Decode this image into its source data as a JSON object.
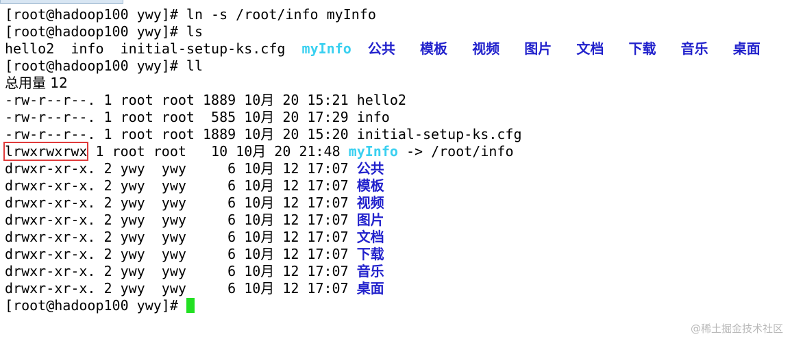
{
  "terminal": {
    "prompt": "[root@hadoop100 ywy]#",
    "commands": {
      "ln": "ln -s /root/info myInfo",
      "ls": "ls",
      "ll": "ll"
    },
    "ls_output": {
      "files": [
        "hello2",
        "info",
        "initial-setup-ks.cfg"
      ],
      "symlink": "myInfo",
      "dirs": [
        "公共",
        "模板",
        "视频",
        "图片",
        "文档",
        "下载",
        "音乐",
        "桌面"
      ]
    },
    "ll_output": {
      "total": "总用量 12",
      "files": [
        {
          "meta": "-rw-r--r--. 1 root root 1889 10月 20 15:21 ",
          "name": "hello2"
        },
        {
          "meta": "-rw-r--r--. 1 root root  585 10月 20 17:29 ",
          "name": "info"
        },
        {
          "meta": "-rw-r--r--. 1 root root 1889 10月 20 15:20 ",
          "name": "initial-setup-ks.cfg"
        }
      ],
      "symlink": {
        "perms": "lrwxrwxrwx",
        "meta": " 1 root root   10 10月 20 21:48 ",
        "name": "myInfo",
        "target": " -> /root/info"
      },
      "dirs": [
        {
          "meta": "drwxr-xr-x. 2 ywy  ywy     6 10月 12 17:07 ",
          "name": "公共"
        },
        {
          "meta": "drwxr-xr-x. 2 ywy  ywy     6 10月 12 17:07 ",
          "name": "模板"
        },
        {
          "meta": "drwxr-xr-x. 2 ywy  ywy     6 10月 12 17:07 ",
          "name": "视频"
        },
        {
          "meta": "drwxr-xr-x. 2 ywy  ywy     6 10月 12 17:07 ",
          "name": "图片"
        },
        {
          "meta": "drwxr-xr-x. 2 ywy  ywy     6 10月 12 17:07 ",
          "name": "文档"
        },
        {
          "meta": "drwxr-xr-x. 2 ywy  ywy     6 10月 12 17:07 ",
          "name": "下载"
        },
        {
          "meta": "drwxr-xr-x. 2 ywy  ywy     6 10月 12 17:07 ",
          "name": "音乐"
        },
        {
          "meta": "drwxr-xr-x. 2 ywy  ywy     6 10月 12 17:07 ",
          "name": "桌面"
        }
      ]
    },
    "colors": {
      "directory": "#2222cc",
      "symlink": "#3ad0f0",
      "cursor": "#22e022",
      "highlight_box": "#e03a3a"
    }
  },
  "watermark": "@稀土掘金技术社区"
}
